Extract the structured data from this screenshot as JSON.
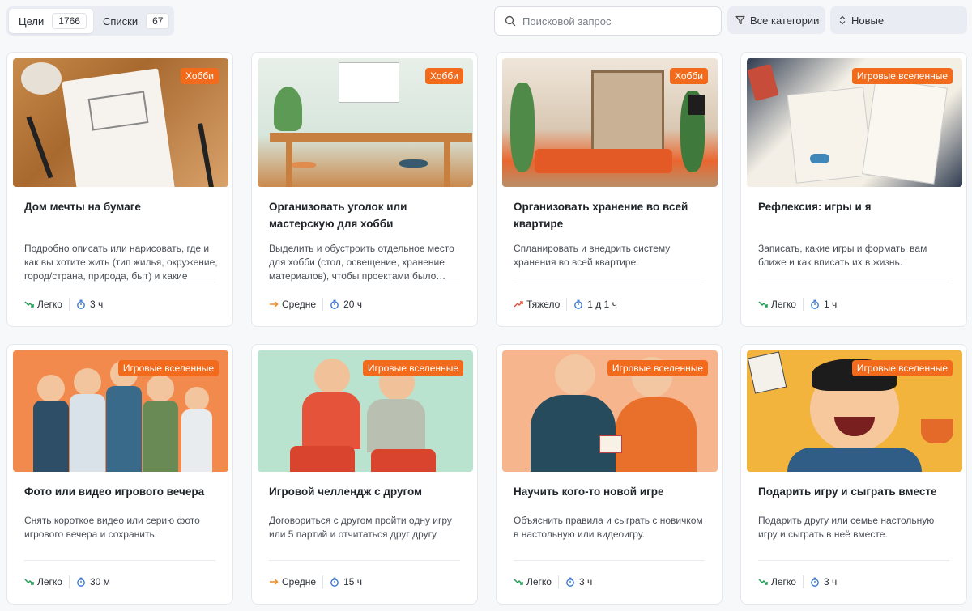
{
  "tabs": [
    {
      "label": "Цели",
      "count": "1766",
      "active": true
    },
    {
      "label": "Списки",
      "count": "67",
      "active": false
    }
  ],
  "search": {
    "placeholder": "Поисковой запрос"
  },
  "filter": {
    "label": "Все категории",
    "icon": "filter-icon"
  },
  "sort": {
    "label": "Новые",
    "icon": "sort-icon"
  },
  "level_colors": {
    "Легко": "#1f9d55",
    "Средне": "#f08a24",
    "Тяжело": "#e5533d"
  },
  "accent": "#f26b1d",
  "cards": [
    {
      "category": "Хобби",
      "title": "Дом мечты на бумаге",
      "description": "Подробно описать или нарисовать, где и как вы хотите жить (тип жилья, окружение, город/страна, природа, быт) и какие шаги…",
      "level": "Легко",
      "time": "3 ч"
    },
    {
      "category": "Хобби",
      "title": "Организовать уголок или мастерскую для хобби",
      "description": "Выделить и обустроить отдельное место для хобби (стол, освещение, хранение материалов), чтобы проектами было…",
      "level": "Средне",
      "time": "20 ч"
    },
    {
      "category": "Хобби",
      "title": "Организовать хранение во всей квартире",
      "description": "Спланировать и внедрить систему хранения во всей квартире.",
      "level": "Тяжело",
      "time": "1 д 1 ч"
    },
    {
      "category": "Игровые вселенные",
      "title": "Рефлексия: игры и я",
      "description": "Записать, какие игры и форматы вам ближе и как вписать их в жизнь.",
      "level": "Легко",
      "time": "1 ч"
    },
    {
      "category": "Игровые вселенные",
      "title": "Фото или видео игрового вечера",
      "description": "Снять короткое видео или серию фото игрового вечера и сохранить.",
      "level": "Легко",
      "time": "30 м"
    },
    {
      "category": "Игровые вселенные",
      "title": "Игровой челлендж с другом",
      "description": "Договориться с другом пройти одну игру или 5 партий и отчитаться друг другу.",
      "level": "Средне",
      "time": "15 ч"
    },
    {
      "category": "Игровые вселенные",
      "title": "Научить кого-то новой игре",
      "description": "Объяснить правила и сыграть с новичком в настольную или видеоигру.",
      "level": "Легко",
      "time": "3 ч"
    },
    {
      "category": "Игровые вселенные",
      "title": "Подарить игру и сыграть вместе",
      "description": "Подарить другу или семье настольную игру и сыграть в неё вместе.",
      "level": "Легко",
      "time": "3 ч"
    }
  ]
}
